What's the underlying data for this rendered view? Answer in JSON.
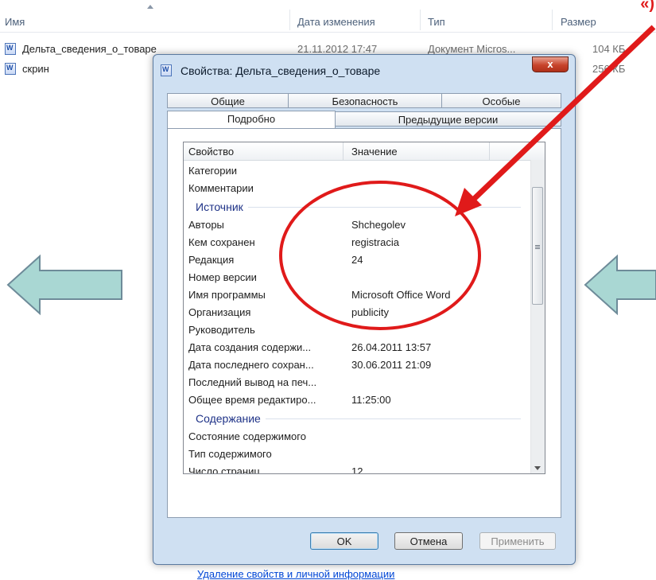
{
  "explorer": {
    "columns": [
      "Имя",
      "Дата изменения",
      "Тип",
      "Размер"
    ],
    "corner_mark": "«)",
    "files": [
      {
        "name": "Дельта_сведения_о_товаре",
        "date": "21.11.2012 17:47",
        "type": "Документ Micros...",
        "size": "104 КБ"
      },
      {
        "name": "скрин",
        "date": "",
        "type": "",
        "size": "256 КБ"
      }
    ]
  },
  "dialog": {
    "title": "Свойства: Дельта_сведения_о_товаре",
    "close_label": "x",
    "tabs_row1": [
      "Общие",
      "Безопасность",
      "Особые"
    ],
    "tabs_row2": [
      "Подробно",
      "Предыдущие версии"
    ],
    "list_header": {
      "property": "Свойство",
      "value": "Значение"
    },
    "rows_top": [
      {
        "k": "Категории",
        "v": ""
      },
      {
        "k": "Комментарии",
        "v": ""
      }
    ],
    "group_source": "Источник",
    "rows_source": [
      {
        "k": "Авторы",
        "v": "Shchegolev"
      },
      {
        "k": "Кем сохранен",
        "v": "registracia"
      },
      {
        "k": "Редакция",
        "v": "24"
      },
      {
        "k": "Номер версии",
        "v": ""
      },
      {
        "k": "Имя программы",
        "v": "Microsoft Office Word"
      },
      {
        "k": "Организация",
        "v": "publicity"
      },
      {
        "k": "Руководитель",
        "v": ""
      },
      {
        "k": "Дата создания содержи...",
        "v": "26.04.2011 13:57"
      },
      {
        "k": "Дата последнего сохран...",
        "v": "30.06.2011 21:09"
      },
      {
        "k": "Последний вывод на печ...",
        "v": ""
      },
      {
        "k": "Общее время редактиро...",
        "v": "11:25:00"
      }
    ],
    "group_content": "Содержание",
    "rows_content": [
      {
        "k": "Состояние содержимого",
        "v": ""
      },
      {
        "k": "Тип содержимого",
        "v": ""
      },
      {
        "k": "Число страниц",
        "v": "12"
      }
    ],
    "remove_link": "Удаление свойств и личной информации",
    "buttons": {
      "ok": "OK",
      "cancel": "Отмена",
      "apply": "Применить"
    }
  },
  "colors": {
    "annotation": "#e01a1a",
    "nav_arrow": "#a9d7d3"
  }
}
